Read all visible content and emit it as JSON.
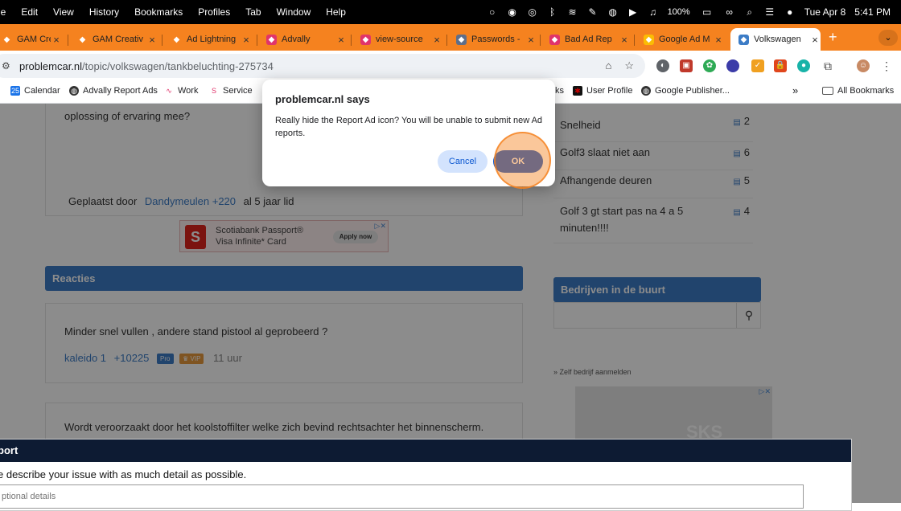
{
  "menubar": {
    "app": "le",
    "menus": [
      "Edit",
      "View",
      "History",
      "Bookmarks",
      "Profiles",
      "Tab",
      "Window",
      "Help"
    ],
    "battery": "100%",
    "date": "Tue Apr 8",
    "time": "5:41 PM"
  },
  "tabs": [
    {
      "title": "GAM Creativ",
      "color": "#f5821f",
      "icon": "gam-icon"
    },
    {
      "title": "GAM Creativ",
      "color": "#f5821f",
      "icon": "gam-icon"
    },
    {
      "title": "Ad Lightning",
      "color": "#f5821f",
      "icon": "adlightning-icon"
    },
    {
      "title": "Advally",
      "color": "#e0346b",
      "icon": "advally-icon"
    },
    {
      "title": "view-source",
      "color": "#e0346b",
      "icon": "advally-icon"
    },
    {
      "title": "Passwords -",
      "color": "#5e6e8a",
      "icon": "key-icon"
    },
    {
      "title": "Bad Ad Rep",
      "color": "#e0346b",
      "icon": "advally-icon"
    },
    {
      "title": "Google Ad M",
      "color": "#fbbc04",
      "icon": "google-ads-icon"
    },
    {
      "title": "Volkswagen",
      "color": "#3c7cc6",
      "icon": "problemcar-icon",
      "active": true
    }
  ],
  "toolbar": {
    "url_host": "problemcar.nl",
    "url_path": "/topic/volkswagen/tankbeluchting-275734"
  },
  "bookmarks": [
    {
      "label": "Calendar",
      "color": "#1a73e8"
    },
    {
      "label": "Advally Report Ads",
      "color": "#333333"
    },
    {
      "label": "Work",
      "color": "#e0346b"
    },
    {
      "label": "Service",
      "color": "#e0346b"
    },
    {
      "label": "ks",
      "color": ""
    },
    {
      "label": "User Profile",
      "color": "#cc0000"
    },
    {
      "label": "Google Publisher...",
      "color": "#333333"
    }
  ],
  "bookmarks_all": "All Bookmarks",
  "page": {
    "post_text": "oplossing of ervaring mee?",
    "posted_by_prefix": "Geplaatst door",
    "posted_by_user": "Dandymeulen +220",
    "posted_by_suffix": "al 5 jaar lid",
    "ad": {
      "line1": "Scotiabank Passport®",
      "line2": "Visa Infinite* Card",
      "button": "Apply now"
    },
    "reacties_title": "Reacties",
    "reply1": {
      "text": "Minder snel vullen , andere stand pistool al geprobeerd ?",
      "user": "kaleido 1",
      "score": "+10225",
      "badge_pro": "Pro",
      "badge_vip": "♛ VIP",
      "time": "11 uur"
    },
    "reply2_text": "Wordt veroorzaakt door het koolstoffilter welke zich bevind rechtsachter het binnenscherm.",
    "related": [
      {
        "title": "Snelheid",
        "count": "2"
      },
      {
        "title": "Golf3 slaat niet aan",
        "count": "6"
      },
      {
        "title": "Afhangende deuren",
        "count": "5"
      },
      {
        "title": "Golf 3 gt start pas na 4 a 5 minuten!!!!",
        "count": "4"
      }
    ],
    "bedrijven_title": "Bedrijven in de buurt",
    "zelf_bedrijf": "» Zelf bedrijf aanmelden",
    "side_ad_text": "SKS"
  },
  "report_panel": {
    "title": "port",
    "description": "e describe your issue with as much detail as possible.",
    "placeholder": "ptional details"
  },
  "dialog": {
    "title": "problemcar.nl says",
    "message": "Really hide the Report Ad icon? You will be unable to submit new Ad reports.",
    "cancel": "Cancel",
    "ok": "OK"
  }
}
